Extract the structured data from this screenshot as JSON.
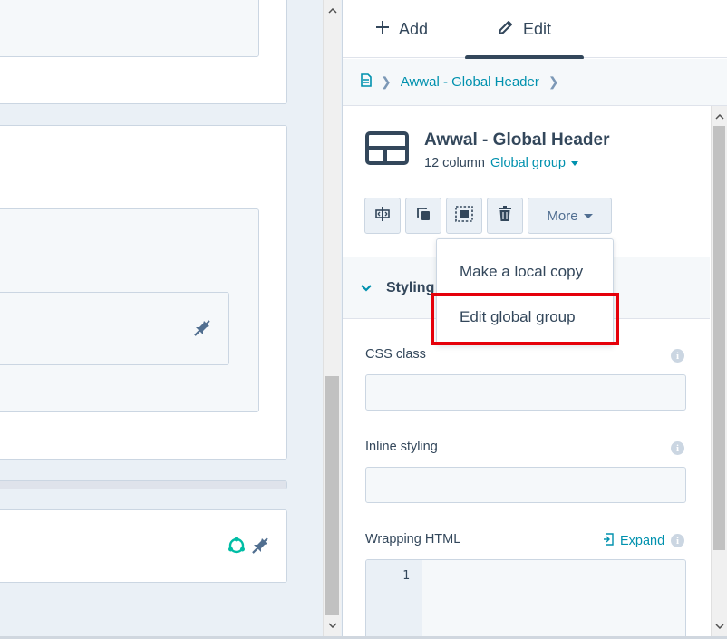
{
  "tabs": {
    "add_label": "Add",
    "edit_label": "Edit"
  },
  "breadcrumb": {
    "item": "Awwal - Global Header"
  },
  "module": {
    "title": "Awwal - Global Header",
    "columns": "12 column",
    "type_link": "Global group"
  },
  "toolbar": {
    "more_label": "More"
  },
  "section": {
    "label": "Styling"
  },
  "fields": {
    "css_class_label": "CSS class",
    "inline_styling_label": "Inline styling",
    "wrapping_html_label": "Wrapping HTML",
    "expand_label": "Expand",
    "line_number": "1"
  },
  "dropdown": {
    "items": [
      "Make a local copy",
      "Edit global group"
    ]
  },
  "colors": {
    "accent": "#0091ae",
    "text": "#33475b",
    "highlight": "#e5000a",
    "info_icon": "#cbd6e2"
  }
}
